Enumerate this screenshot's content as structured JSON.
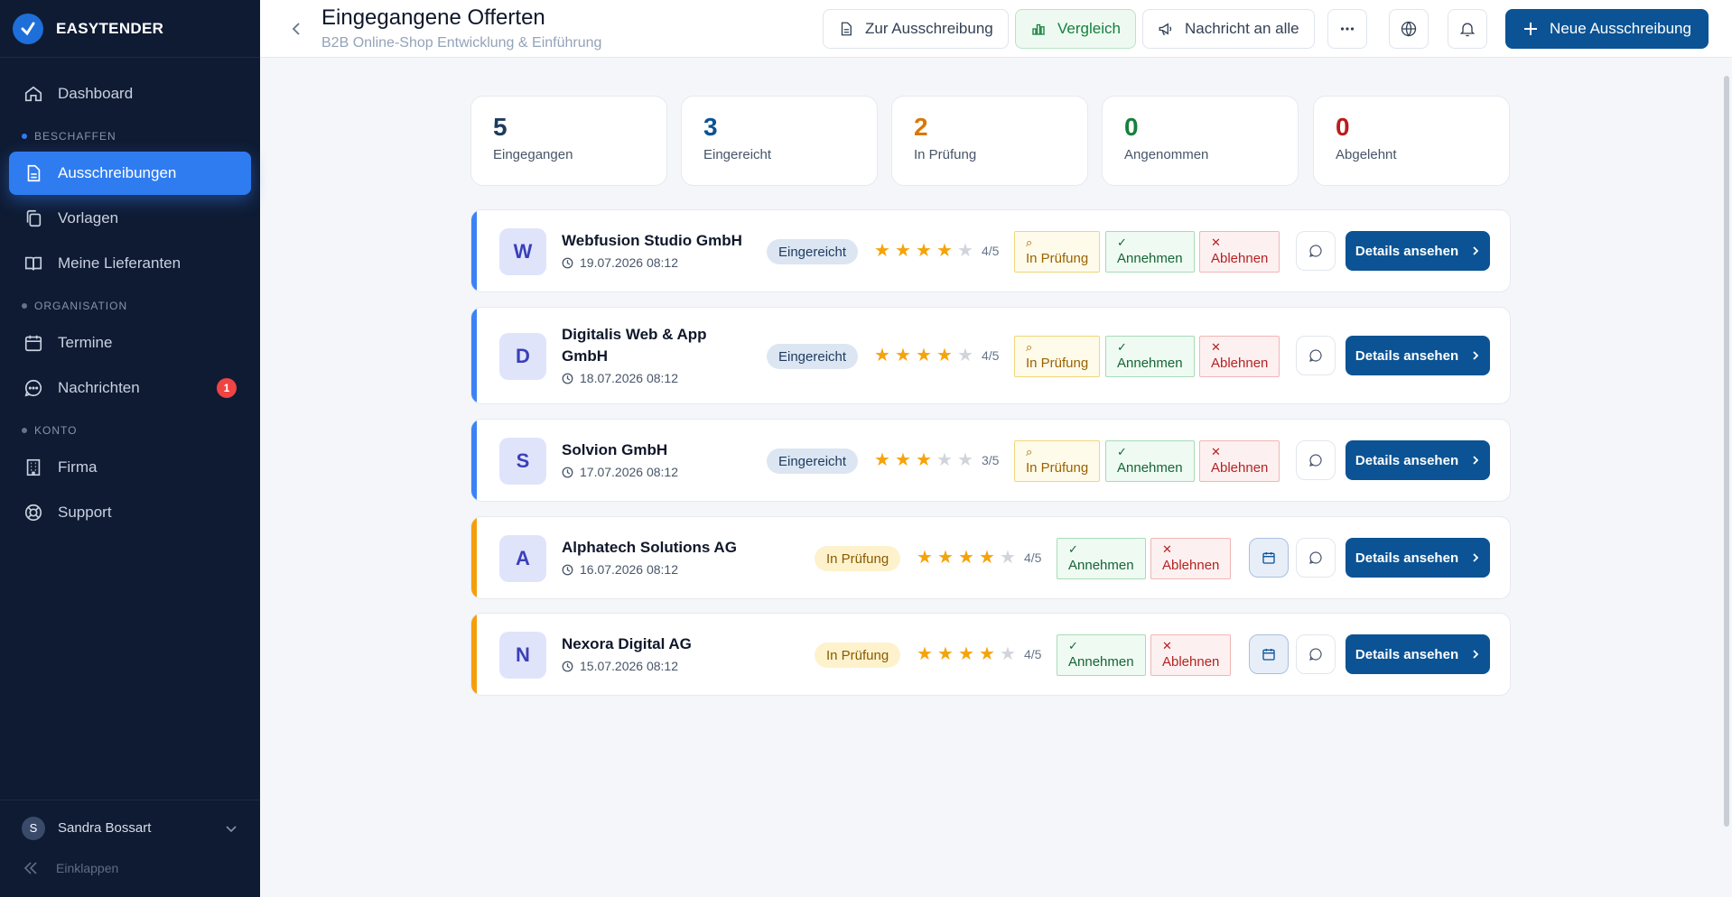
{
  "brand": {
    "name": "EASYTENDER"
  },
  "sidebar": {
    "items": [
      {
        "label": "Dashboard"
      },
      {
        "label": "Ausschreibungen"
      },
      {
        "label": "Vorlagen"
      },
      {
        "label": "Meine Lieferanten"
      },
      {
        "label": "Termine"
      },
      {
        "label": "Nachrichten",
        "badge": "1"
      },
      {
        "label": "Firma"
      },
      {
        "label": "Support"
      }
    ],
    "sections": [
      "BESCHAFFEN",
      "ORGANISATION",
      "KONTO"
    ],
    "user": {
      "initial": "S",
      "name": "Sandra Bossart"
    },
    "collapse_label": "Einklappen"
  },
  "header": {
    "title": "Eingegangene Offerten",
    "subtitle": "B2B Online-Shop Entwicklung & Einführung",
    "btn_tender": "Zur Ausschreibung",
    "btn_compare": "Vergleich",
    "btn_message_all": "Nachricht an alle",
    "btn_new": "Neue Ausschreibung"
  },
  "stats": [
    {
      "value": "5",
      "label": "Eingegangen",
      "color": "#1e3a5f"
    },
    {
      "value": "3",
      "label": "Eingereicht",
      "color": "#0b5394"
    },
    {
      "value": "2",
      "label": "In Prüfung",
      "color": "#d97706"
    },
    {
      "value": "0",
      "label": "Angenommen",
      "color": "#15803d"
    },
    {
      "value": "0",
      "label": "Abgelehnt",
      "color": "#b91c1c"
    }
  ],
  "actions": {
    "review": "In Prüfung",
    "accept": "Annehmen",
    "reject": "Ablehnen",
    "details": "Details ansehen"
  },
  "offers": [
    {
      "initial": "W",
      "company": "Webfusion Studio GmbH",
      "date": "19.07.2026 08:12",
      "status": "Eingereicht",
      "rating": 4,
      "rating_text": "4/5"
    },
    {
      "initial": "D",
      "company": "Digitalis Web & App GmbH",
      "date": "18.07.2026 08:12",
      "status": "Eingereicht",
      "rating": 4,
      "rating_text": "4/5"
    },
    {
      "initial": "S",
      "company": "Solvion GmbH",
      "date": "17.07.2026 08:12",
      "status": "Eingereicht",
      "rating": 3,
      "rating_text": "3/5"
    },
    {
      "initial": "A",
      "company": "Alphatech Solutions AG",
      "date": "16.07.2026 08:12",
      "status": "In Prüfung",
      "rating": 4,
      "rating_text": "4/5"
    },
    {
      "initial": "N",
      "company": "Nexora Digital AG",
      "date": "15.07.2026 08:12",
      "status": "In Prüfung",
      "rating": 4,
      "rating_text": "4/5"
    }
  ],
  "colors": {
    "accent": "#2f7cf0",
    "primary": "#0b5394",
    "submitted_stripe": "#3b82f6",
    "review_stripe": "#f59e0b"
  }
}
